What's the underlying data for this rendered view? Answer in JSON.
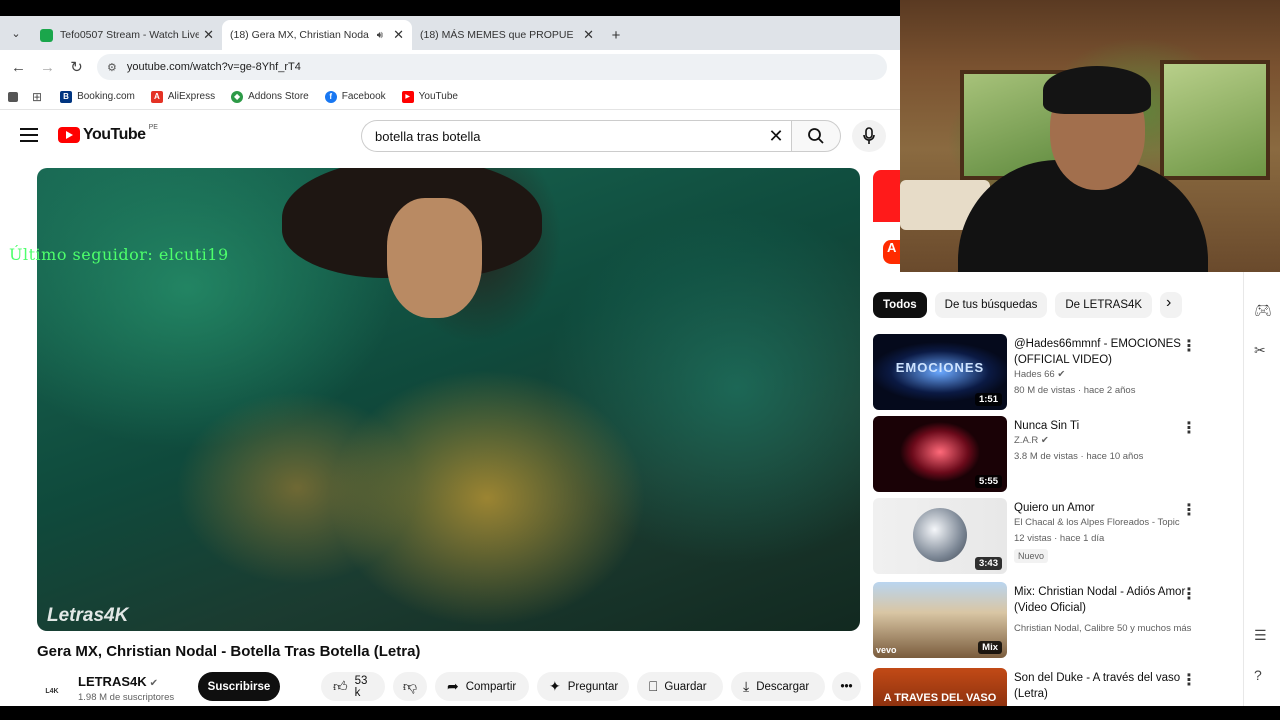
{
  "browser": {
    "tabs": [
      {
        "title": "Tefo0507 Stream - Watch Live o",
        "favicon": "kick-icon",
        "active": false
      },
      {
        "title": "(18) Gera MX, Christian Noda",
        "favicon": "youtube-icon",
        "active": true,
        "audio": true
      },
      {
        "title": "(18) MÁS MEMES que PROPUE",
        "favicon": "youtube-icon",
        "active": false
      }
    ],
    "url": "youtube.com/watch?v=ge-8Yhf_rT4",
    "bookmarks": [
      {
        "label": "Booking.com",
        "color": "#003580",
        "glyph": "B"
      },
      {
        "label": "AliExpress",
        "color": "#e43225",
        "glyph": "A"
      },
      {
        "label": "Addons Store",
        "color": "#2d9a47",
        "glyph": "◆"
      },
      {
        "label": "Facebook",
        "color": "#1877f2",
        "glyph": "f"
      },
      {
        "label": "YouTube",
        "color": "#ff0000",
        "glyph": "▶"
      }
    ]
  },
  "youtube": {
    "logo_text": "YouTube",
    "country_code": "PE",
    "search_query": "botella tras botella",
    "overlay_text": "Último seguidor: elcuti19",
    "player_watermark": "Letras4K",
    "video_title": "Gera MX, Christian Nodal - Botella Tras Botella (Letra)",
    "channel": {
      "name": "LETRAS4K",
      "subscribers": "1.98 M de suscriptores",
      "subscribe_label": "Suscribirse"
    },
    "actions": {
      "likes": "53 k",
      "share": "Compartir",
      "ask": "Preguntar",
      "save": "Guardar",
      "download": "Descargar"
    },
    "chips": [
      "Todos",
      "De tus búsquedas",
      "De LETRAS4K"
    ],
    "recommendations": [
      {
        "title": "@Hades66mmnf - EMOCIONES (OFFICIAL VIDEO)",
        "channel": "Hades 66",
        "verified": true,
        "meta": "80 M de vistas · hace 2 años",
        "duration": "1:51",
        "badge": ""
      },
      {
        "title": "Nunca Sin Ti",
        "channel": "Z.A.R",
        "verified": true,
        "meta": "3.8 M de vistas · hace 10 años",
        "duration": "5:55",
        "badge": ""
      },
      {
        "title": "Quiero un Amor",
        "channel": "El Chacal & los Alpes Floreados - Topic",
        "verified": false,
        "meta": "12 vistas · hace 1 día",
        "duration": "3:43",
        "badge": "Nuevo"
      },
      {
        "title": "Mix: Christian Nodal - Adiós Amor (Video Oficial)",
        "channel": "Christian Nodal, Calibre 50 y muchos más",
        "verified": false,
        "meta": "",
        "duration": "Mix",
        "badge": ""
      },
      {
        "title": "Son del Duke - A través del vaso (Letra)",
        "channel": "",
        "verified": false,
        "meta": "",
        "duration": "",
        "badge": ""
      }
    ],
    "thumb_texts": [
      "EMOCIONES",
      "",
      "",
      "vevo",
      "A TRAVES DEL VASO"
    ]
  }
}
